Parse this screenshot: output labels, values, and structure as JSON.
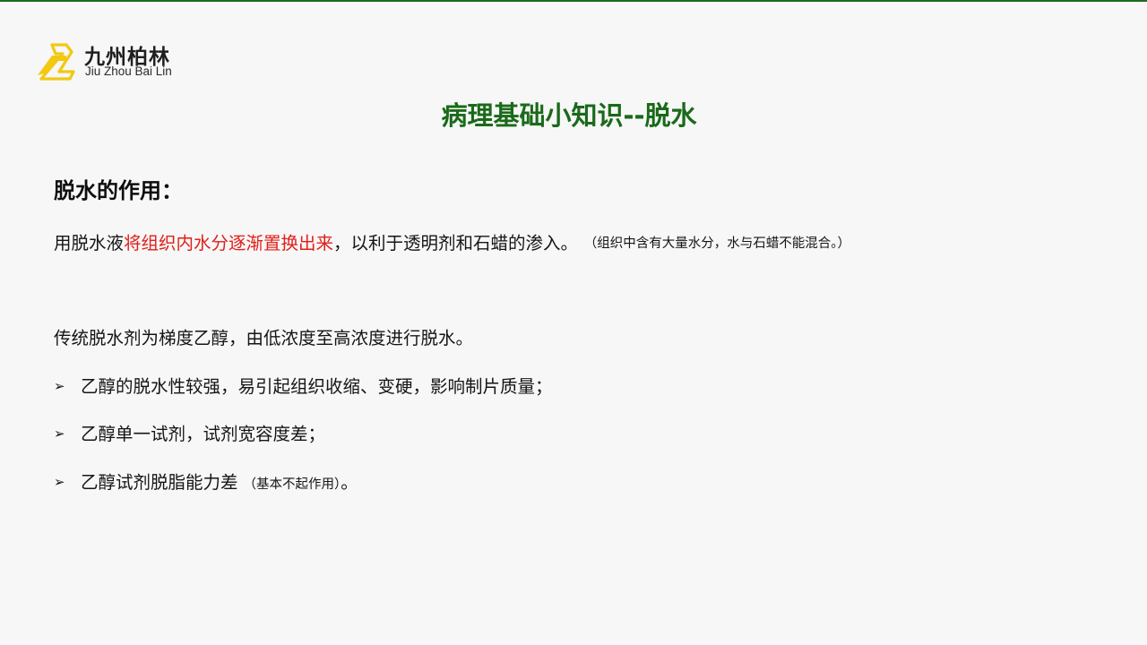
{
  "colors": {
    "accent_green": "#1a6a1a",
    "highlight_red": "#e0201a",
    "logo_yellow": "#f2c811"
  },
  "logo": {
    "icon": "zb-mark-icon",
    "cn": "九州柏林",
    "en": "Jiu Zhou Bai Lin"
  },
  "title": "病理基础小知识--脱水",
  "section": {
    "heading": "脱水的作用："
  },
  "paragraph1": {
    "part1": "用脱水液",
    "highlight": "将组织内水分逐渐置换出来",
    "part2": "，以利于透明剂和石蜡的渗入。",
    "note": "（组织中含有大量水分，水与石蜡不能混合。）"
  },
  "paragraph2": "传统脱水剂为梯度乙醇，由低浓度至高浓度进行脱水。",
  "bullets": [
    {
      "marker": "➢",
      "text": "乙醇的脱水性较强，易引起组织收缩、变硬，影响制片质量；"
    },
    {
      "marker": "➢",
      "text": "乙醇单一试剂，试剂宽容度差；"
    },
    {
      "marker": "➢",
      "text": "乙醇试剂脱脂能力差",
      "note": "（基本不起作用）",
      "tail": "。"
    }
  ]
}
